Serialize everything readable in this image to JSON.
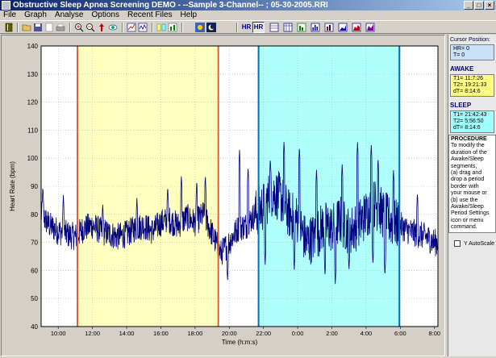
{
  "window": {
    "title": "Obstructive Sleep Apnea Screening DEMO - --Sample 3-Channel-- ; 05-30-2005.RRI",
    "minimize": "_",
    "maximize": "□",
    "close": "×"
  },
  "menu": [
    "File",
    "Graph",
    "Analyse",
    "Options",
    "Recent Files",
    "Help"
  ],
  "toolbar": {
    "hr_label": "HR",
    "hr2_label": "HR",
    "rr_label": "RR"
  },
  "panel": {
    "cursor_title": "Cursor Position:",
    "cursor_hr": "HR= 0",
    "cursor_t": "T=   0",
    "awake_title": "AWAKE",
    "awake_t1": "T1= 11:7:26",
    "awake_t2": "T2= 19:21:33",
    "awake_dt": "dT=  8:14:6",
    "sleep_title": "SLEEP",
    "sleep_t1": "T1= 21:42:43",
    "sleep_t2": "T2= 5:56:50",
    "sleep_dt": "dT=  8:14:6",
    "procedure_title": "PROCEDURE",
    "procedure_lines": [
      "To modify the",
      "duration of the",
      "Awake/Sleep",
      "segments,",
      "(a) drag and",
      "drop a period",
      "border with",
      "your mouse or",
      "(b) use the",
      "Awake/Sleep",
      "Period Settings",
      "icon or menu",
      "command."
    ],
    "autoscale_label": "Y AutoScale"
  },
  "colors": {
    "awake_fill": "#ffffc0",
    "sleep_fill": "#b0ffff",
    "awake_border": "#e06030",
    "sleep_border": "#0070c0",
    "trace": "#000080",
    "cursor_box": "#c8e0f8",
    "awake_box": "#ffff80",
    "sleep_box": "#a0ffff"
  },
  "chart_data": {
    "type": "line",
    "xlabel": "Time (h:m:s)",
    "ylabel": "Heart Rate (bpm)",
    "ylim": [
      40,
      140
    ],
    "yticks": [
      40,
      50,
      60,
      70,
      80,
      90,
      100,
      110,
      120,
      130,
      140
    ],
    "x_range_hours": [
      9.0,
      32.2
    ],
    "xticks": [
      {
        "h": 10,
        "label": "10:00"
      },
      {
        "h": 12,
        "label": "12:00"
      },
      {
        "h": 14,
        "label": "14:00"
      },
      {
        "h": 16,
        "label": "16:00"
      },
      {
        "h": 18,
        "label": "18:00"
      },
      {
        "h": 20,
        "label": "20:00"
      },
      {
        "h": 22,
        "label": "22:00"
      },
      {
        "h": 24,
        "label": "0:00"
      },
      {
        "h": 26,
        "label": "2:00"
      },
      {
        "h": 28,
        "label": "4:00"
      },
      {
        "h": 30,
        "label": "6:00"
      },
      {
        "h": 32,
        "label": "8:00"
      }
    ],
    "awake_period_hours": [
      11.124,
      19.359
    ],
    "sleep_period_hours": [
      21.712,
      29.947
    ],
    "grid": true,
    "series": [
      {
        "x": [
          9.0,
          9.5,
          10.0,
          10.5,
          11.0,
          11.5,
          12.0,
          12.5,
          13.0,
          13.5,
          14.0,
          14.5,
          15.0,
          15.5,
          16.0,
          16.5,
          17.0,
          17.5,
          18.0,
          18.5,
          19.0,
          19.5,
          20.0,
          20.5,
          21.0,
          21.5,
          22.0,
          22.5,
          23.0,
          23.5,
          24.0,
          24.5,
          25.0,
          25.5,
          26.0,
          26.5,
          27.0,
          27.5,
          28.0,
          28.5,
          29.0,
          29.5,
          30.0,
          30.5,
          31.0,
          31.5,
          32.0,
          32.2
        ],
        "y": [
          80,
          76,
          74,
          73,
          72,
          75,
          76,
          74,
          73,
          72,
          73,
          75,
          76,
          74,
          77,
          78,
          76,
          79,
          77,
          80,
          73,
          66,
          70,
          75,
          76,
          80,
          83,
          88,
          86,
          80,
          78,
          70,
          72,
          76,
          75,
          78,
          74,
          76,
          80,
          84,
          80,
          77,
          76,
          74,
          73,
          72,
          70,
          70
        ],
        "peaks": [
          {
            "x": 9.1,
            "y": 90
          },
          {
            "x": 10.3,
            "y": 87
          },
          {
            "x": 12.6,
            "y": 84
          },
          {
            "x": 14.6,
            "y": 86
          },
          {
            "x": 16.4,
            "y": 90
          },
          {
            "x": 17.2,
            "y": 94
          },
          {
            "x": 18.1,
            "y": 92
          },
          {
            "x": 18.6,
            "y": 94
          },
          {
            "x": 20.6,
            "y": 103
          },
          {
            "x": 21.1,
            "y": 97
          },
          {
            "x": 22.4,
            "y": 100
          },
          {
            "x": 23.2,
            "y": 106
          },
          {
            "x": 24.1,
            "y": 104
          },
          {
            "x": 25.1,
            "y": 96
          },
          {
            "x": 26.6,
            "y": 98
          },
          {
            "x": 27.5,
            "y": 106
          },
          {
            "x": 28.3,
            "y": 105
          },
          {
            "x": 28.7,
            "y": 100
          },
          {
            "x": 29.6,
            "y": 96
          },
          {
            "x": 31.0,
            "y": 88
          }
        ],
        "troughs": [
          {
            "x": 19.9,
            "y": 56
          },
          {
            "x": 22.1,
            "y": 62
          },
          {
            "x": 23.8,
            "y": 60
          },
          {
            "x": 25.6,
            "y": 58
          },
          {
            "x": 26.2,
            "y": 55
          },
          {
            "x": 27.0,
            "y": 60
          },
          {
            "x": 28.4,
            "y": 62
          },
          {
            "x": 29.1,
            "y": 58
          }
        ]
      }
    ]
  }
}
